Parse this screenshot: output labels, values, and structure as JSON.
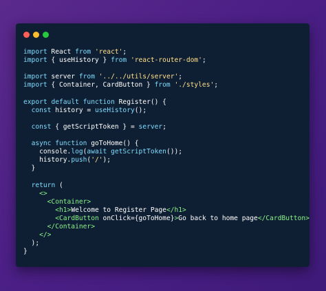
{
  "window": {
    "controls": [
      {
        "name": "close",
        "color": "#ff5f56"
      },
      {
        "name": "minimize",
        "color": "#ffbd2e"
      },
      {
        "name": "maximize",
        "color": "#27c93f"
      }
    ]
  },
  "code_lines": [
    [
      {
        "t": "import",
        "c": "kw"
      },
      {
        "t": " React ",
        "c": "fn"
      },
      {
        "t": "from",
        "c": "kw"
      },
      {
        "t": " ",
        "c": "fn"
      },
      {
        "t": "'react'",
        "c": "str"
      },
      {
        "t": ";",
        "c": "punc"
      }
    ],
    [
      {
        "t": "import",
        "c": "kw"
      },
      {
        "t": " { useHistory } ",
        "c": "fn"
      },
      {
        "t": "from",
        "c": "kw"
      },
      {
        "t": " ",
        "c": "fn"
      },
      {
        "t": "'react-router-dom'",
        "c": "str"
      },
      {
        "t": ";",
        "c": "punc"
      }
    ],
    [],
    [
      {
        "t": "import",
        "c": "kw"
      },
      {
        "t": " server ",
        "c": "fn"
      },
      {
        "t": "from",
        "c": "kw"
      },
      {
        "t": " ",
        "c": "fn"
      },
      {
        "t": "'../../utils/server'",
        "c": "str"
      },
      {
        "t": ";",
        "c": "punc"
      }
    ],
    [
      {
        "t": "import",
        "c": "kw"
      },
      {
        "t": " { Container, CardButton } ",
        "c": "fn"
      },
      {
        "t": "from",
        "c": "kw"
      },
      {
        "t": " ",
        "c": "fn"
      },
      {
        "t": "'./styles'",
        "c": "str"
      },
      {
        "t": ";",
        "c": "punc"
      }
    ],
    [],
    [
      {
        "t": "export",
        "c": "kw"
      },
      {
        "t": " ",
        "c": "fn"
      },
      {
        "t": "default",
        "c": "kw"
      },
      {
        "t": " ",
        "c": "fn"
      },
      {
        "t": "function",
        "c": "kw"
      },
      {
        "t": " Register() {",
        "c": "fn"
      }
    ],
    [
      {
        "t": "  ",
        "c": "fn"
      },
      {
        "t": "const",
        "c": "kw"
      },
      {
        "t": " history = ",
        "c": "fn"
      },
      {
        "t": "useHistory",
        "c": "call"
      },
      {
        "t": "();",
        "c": "punc"
      }
    ],
    [],
    [
      {
        "t": "  ",
        "c": "fn"
      },
      {
        "t": "const",
        "c": "kw"
      },
      {
        "t": " { getScriptToken } = ",
        "c": "fn"
      },
      {
        "t": "server",
        "c": "call"
      },
      {
        "t": ";",
        "c": "punc"
      }
    ],
    [],
    [
      {
        "t": "  ",
        "c": "fn"
      },
      {
        "t": "async",
        "c": "kw"
      },
      {
        "t": " ",
        "c": "fn"
      },
      {
        "t": "function",
        "c": "kw"
      },
      {
        "t": " goToHome() {",
        "c": "fn"
      }
    ],
    [
      {
        "t": "    console.",
        "c": "fn"
      },
      {
        "t": "log",
        "c": "call"
      },
      {
        "t": "(",
        "c": "punc"
      },
      {
        "t": "await",
        "c": "kw"
      },
      {
        "t": " ",
        "c": "fn"
      },
      {
        "t": "getScriptToken",
        "c": "call"
      },
      {
        "t": "());",
        "c": "punc"
      }
    ],
    [
      {
        "t": "    history.",
        "c": "fn"
      },
      {
        "t": "push",
        "c": "call"
      },
      {
        "t": "(",
        "c": "punc"
      },
      {
        "t": "'/'",
        "c": "str"
      },
      {
        "t": ");",
        "c": "punc"
      }
    ],
    [
      {
        "t": "  }",
        "c": "fn"
      }
    ],
    [],
    [
      {
        "t": "  ",
        "c": "fn"
      },
      {
        "t": "return",
        "c": "kw"
      },
      {
        "t": " (",
        "c": "fn"
      }
    ],
    [
      {
        "t": "    ",
        "c": "fn"
      },
      {
        "t": "<>",
        "c": "tag"
      }
    ],
    [
      {
        "t": "      ",
        "c": "fn"
      },
      {
        "t": "<Container>",
        "c": "tag"
      }
    ],
    [
      {
        "t": "        ",
        "c": "fn"
      },
      {
        "t": "<h1>",
        "c": "tag"
      },
      {
        "t": "Welcome to Register Page",
        "c": "fn"
      },
      {
        "t": "</h1>",
        "c": "tag"
      }
    ],
    [
      {
        "t": "        ",
        "c": "fn"
      },
      {
        "t": "<CardButton",
        "c": "tag"
      },
      {
        "t": " onClick={goToHome}",
        "c": "attr"
      },
      {
        "t": ">",
        "c": "tag"
      },
      {
        "t": "Go back to home page",
        "c": "fn"
      },
      {
        "t": "</CardButton>",
        "c": "tag"
      }
    ],
    [
      {
        "t": "      ",
        "c": "fn"
      },
      {
        "t": "</Container>",
        "c": "tag"
      }
    ],
    [
      {
        "t": "    ",
        "c": "fn"
      },
      {
        "t": "</>",
        "c": "tag"
      }
    ],
    [
      {
        "t": "  );",
        "c": "fn"
      }
    ],
    [
      {
        "t": "}",
        "c": "fn"
      }
    ]
  ]
}
